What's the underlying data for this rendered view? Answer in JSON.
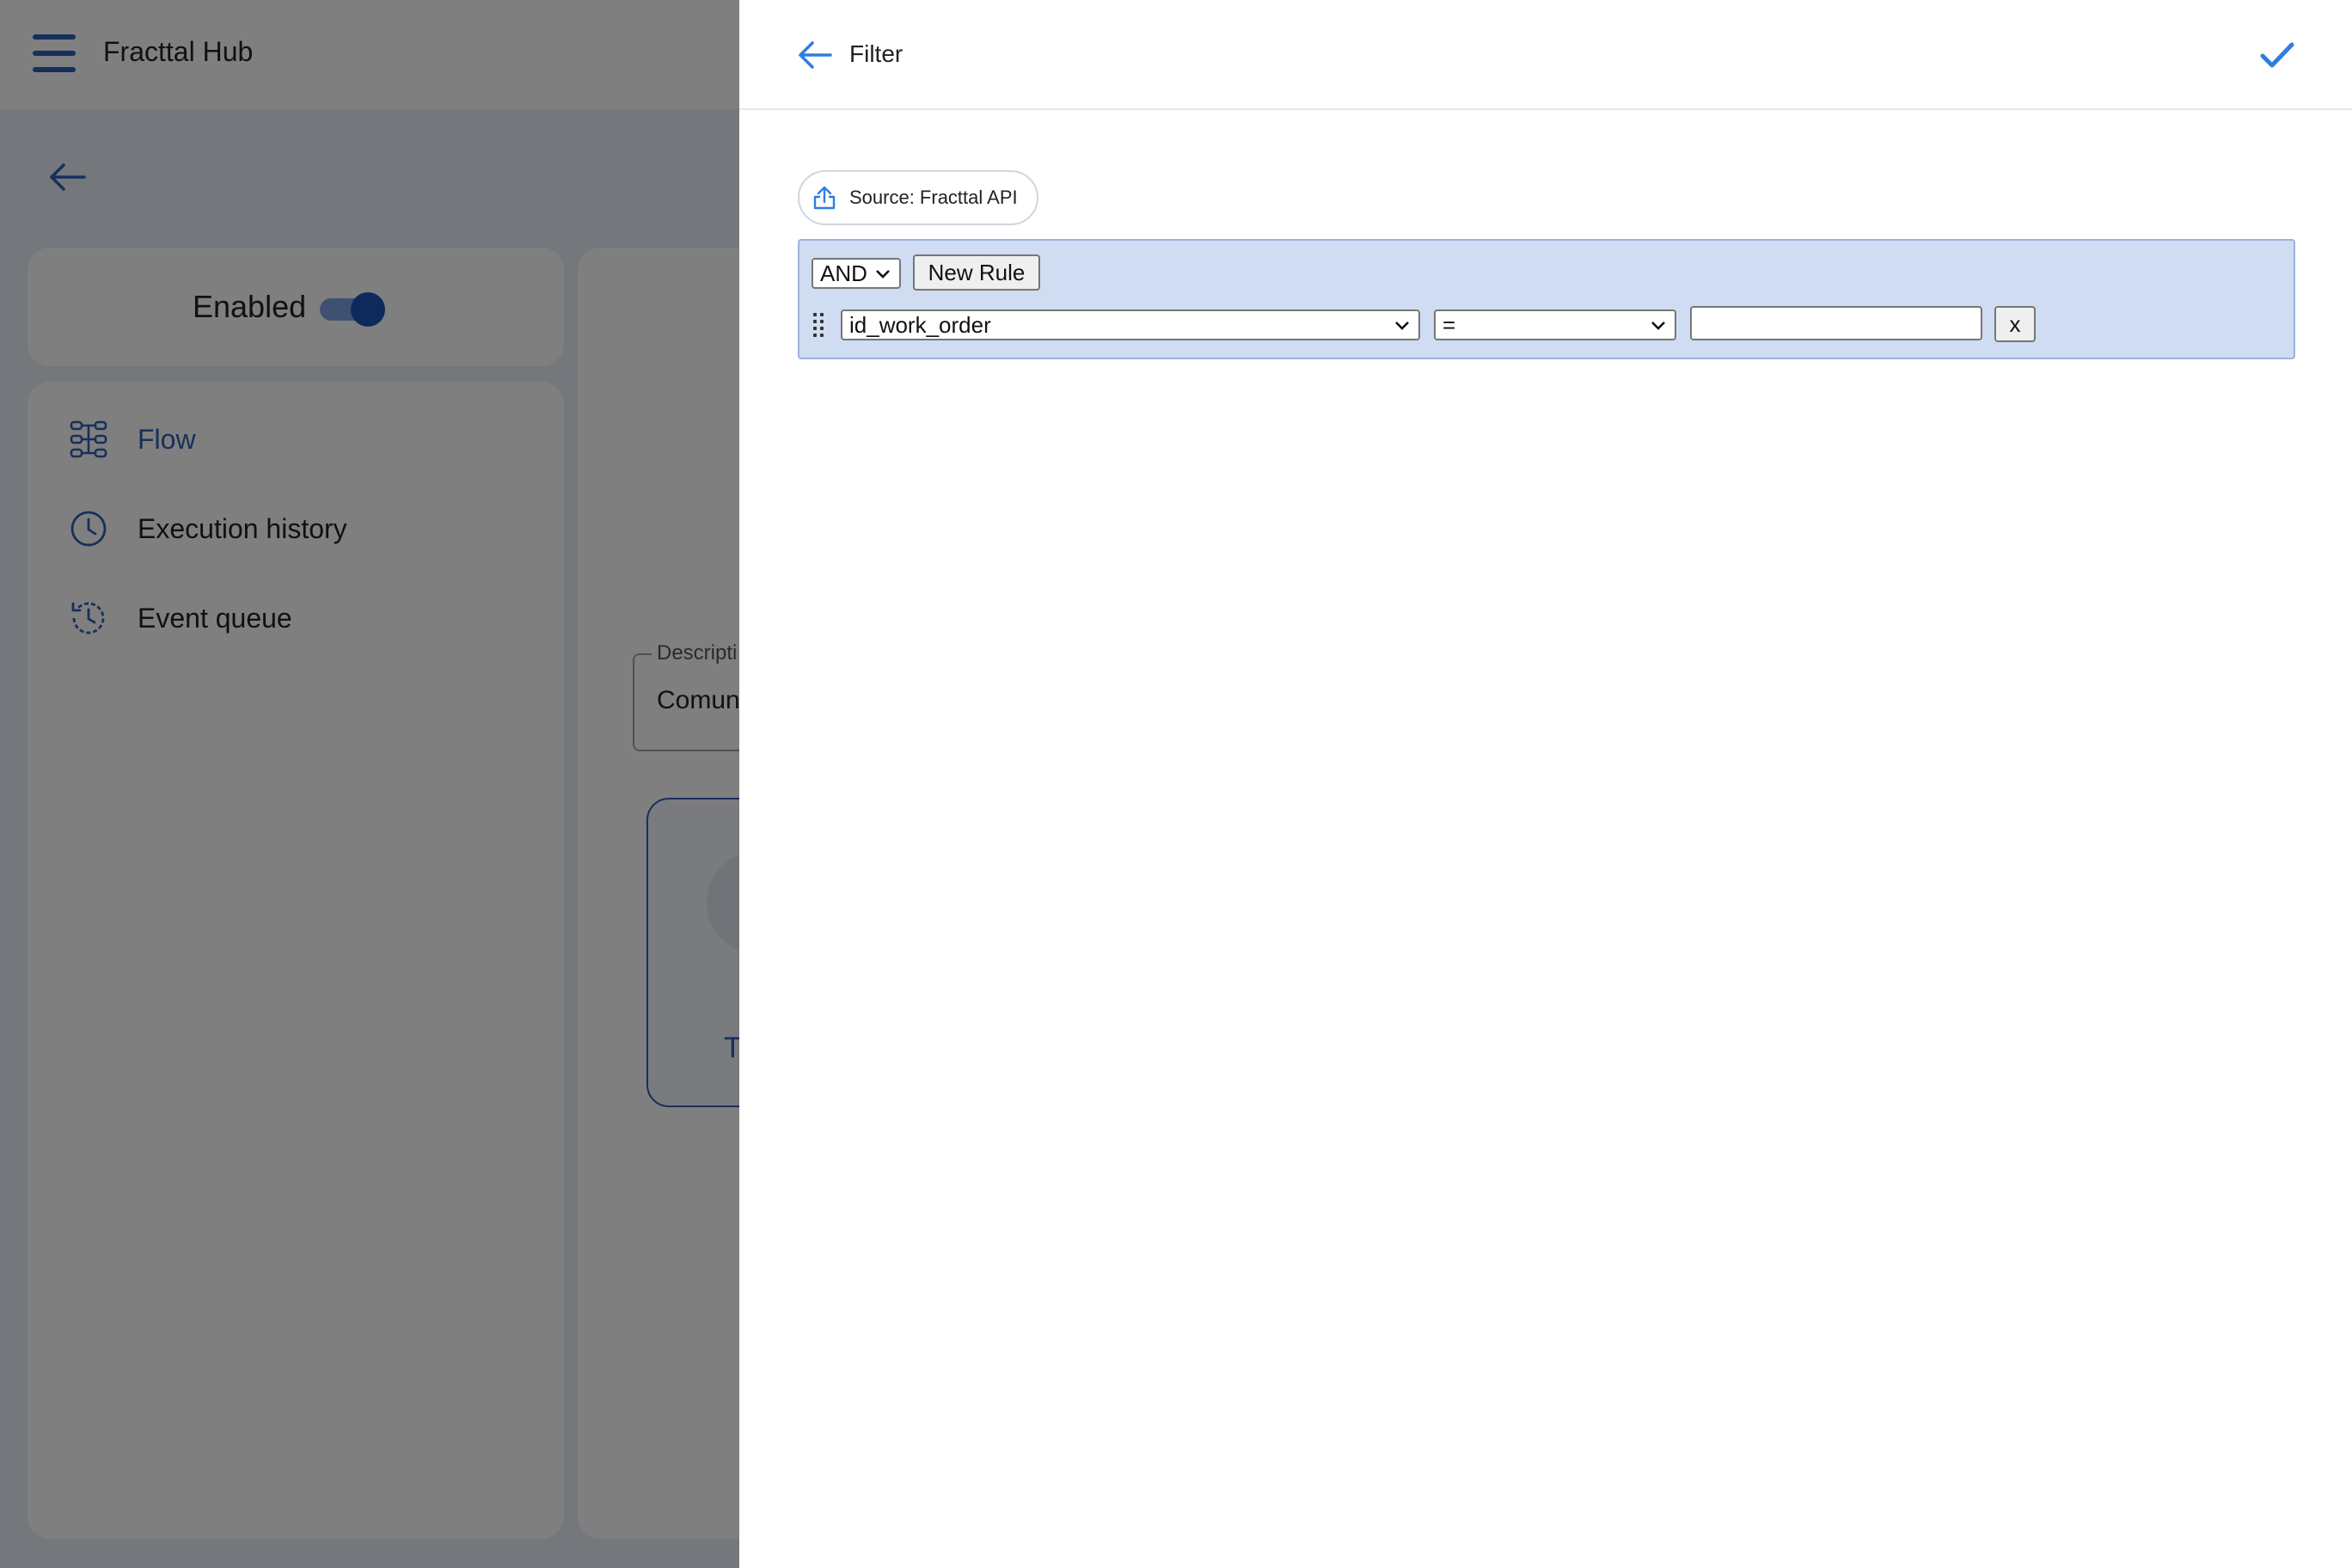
{
  "app": {
    "title": "Fracttal Hub",
    "status_label": "Enabled",
    "toggle_on": true,
    "nav": [
      {
        "label": "Flow",
        "icon": "flow-icon",
        "active": true
      },
      {
        "label": "Execution history",
        "icon": "clock-icon",
        "active": false
      },
      {
        "label": "Event queue",
        "icon": "history-icon",
        "active": false
      }
    ],
    "description_label": "Descripti",
    "description_value": "Comun",
    "node_label": "T"
  },
  "filter_panel": {
    "title": "Filter",
    "source_chip": "Source: Fracttal API",
    "group": {
      "combinator": "AND",
      "new_rule_label": "New Rule",
      "rule": {
        "field": "id_work_order",
        "operator": "=",
        "value": "",
        "remove_label": "x"
      }
    }
  },
  "colors": {
    "accent": "#2f5fb8",
    "check": "#2f7de1",
    "rule_group_bg": "#cfdcf2"
  }
}
